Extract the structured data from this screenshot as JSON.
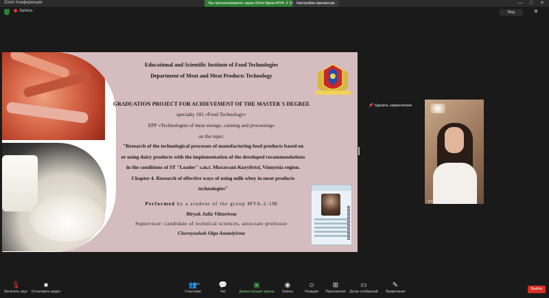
{
  "titlebar": {
    "app_title": "Zoom Конференция",
    "share_notice": "Вы просматриваете экран Юлія Бірюк MYA -2 1M",
    "view_options": "Настройки просмотра",
    "win_min": "—",
    "win_max": "□",
    "win_close": "✕"
  },
  "topbar": {
    "rec_label": "Запись",
    "view_button": "Вид",
    "clock_icon": "⊞"
  },
  "slide": {
    "institute": "Educational and Scientific Institute of Food Technologies",
    "department": "Department of Meat and Meat Products Technology",
    "project_title": "GRADUATION PROJECT FOR ACHIEVEMENT OF THE MASTER`S DEGREE",
    "specialty": "specialty 181 «Food Technology»",
    "epp": "EPP «Technologies of meat storage, canning and processing»",
    "topic_intro": "on the topic:",
    "topic_line1": "\"Research of the technological processes of manufacturing food products based on",
    "topic_line2": "or using dairy products with the implementation of the developed recommendations",
    "topic_line3": "in the conditions of ST \"Leader\" s.m.t. Murawani-Kurylivtsi, Vinnytsia region.",
    "topic_line4": "Chapter 4. Research of effective ways of using milk whey in meat products",
    "topic_line5": "technologies\"",
    "performed_bold": "Performed",
    "performed_rest": " by a student of the group MYA-2-1M",
    "student": "Biryuk Julia Viktorivna",
    "supervisor": "Supervisor: candidate of technical sciences, associate professor",
    "supervisor_name": "Chernyushok Olga Anatolyivna"
  },
  "participants": {
    "unpin_label": "Удалить закрепление",
    "tile_name": "Юлія Бірюк ЮЯН"
  },
  "toolbar": {
    "mic": "Включить звук",
    "video": "Остановить видео",
    "participants": "Участники",
    "participants_count": "20",
    "chat": "Чат",
    "share": "Демонстрация экрана",
    "record": "Запись",
    "reactions": "Реакции",
    "apps": "Приложения",
    "whiteboard": "Доски сообщений",
    "notes": "Примечания",
    "end": "Выйти"
  },
  "colors": {
    "slide_bg": "#d5bcbe",
    "share_green": "#2e7d32",
    "end_red": "#d93025"
  }
}
